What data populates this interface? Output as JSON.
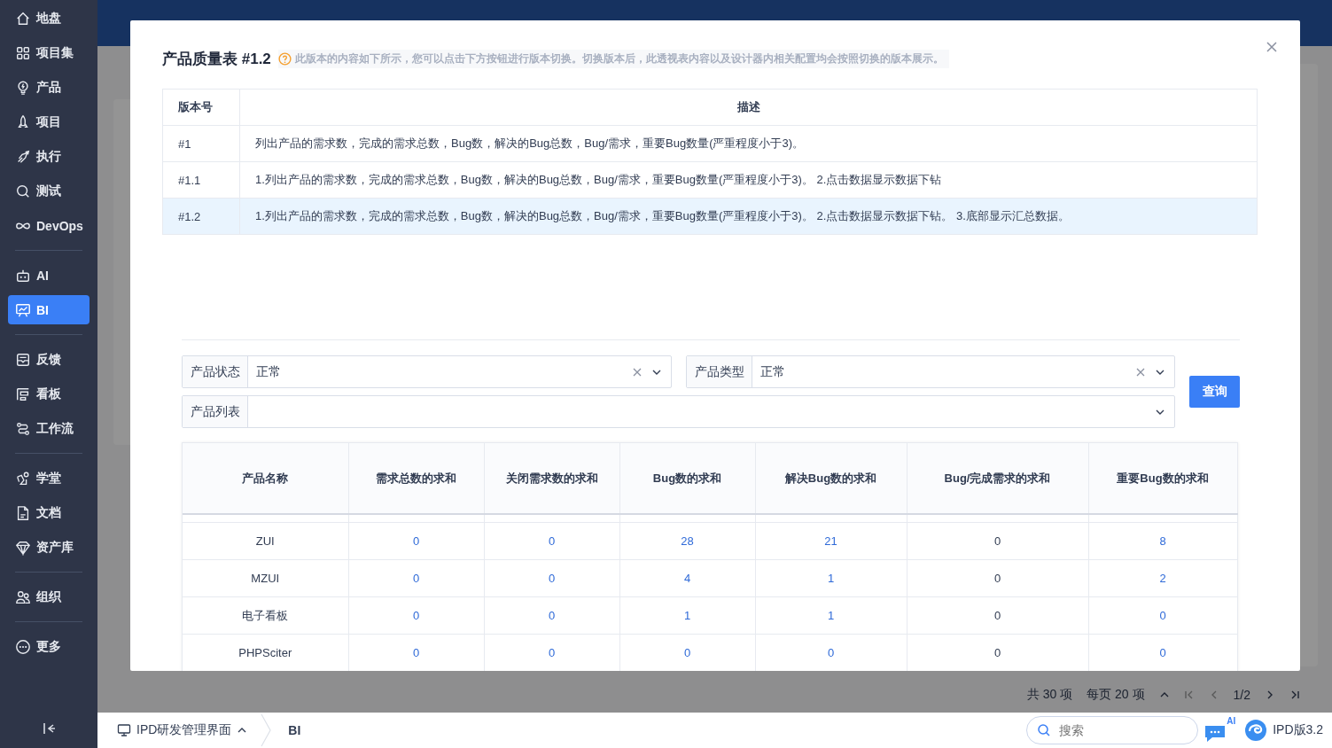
{
  "sidebar": {
    "groups": [
      [
        {
          "label": "地盘",
          "selected": false
        },
        {
          "label": "项目集",
          "selected": false
        },
        {
          "label": "产品",
          "selected": false
        },
        {
          "label": "项目",
          "selected": false
        },
        {
          "label": "执行",
          "selected": false
        },
        {
          "label": "测试",
          "selected": false
        },
        {
          "label": "DevOps",
          "selected": false
        }
      ],
      [
        {
          "label": "AI",
          "selected": false
        },
        {
          "label": "BI",
          "selected": true
        }
      ],
      [
        {
          "label": "反馈",
          "selected": false
        },
        {
          "label": "看板",
          "selected": false
        },
        {
          "label": "工作流",
          "selected": false
        }
      ],
      [
        {
          "label": "学堂",
          "selected": false
        },
        {
          "label": "文档",
          "selected": false
        },
        {
          "label": "资产库",
          "selected": false
        }
      ],
      [
        {
          "label": "组织",
          "selected": false
        }
      ],
      [
        {
          "label": "更多",
          "selected": false
        }
      ]
    ]
  },
  "pagination": {
    "total": "共 30 项",
    "page_size": "每页 20 项",
    "page": "1/2"
  },
  "bottom_bar": {
    "app": "IPD研发管理界面",
    "crumb": "BI",
    "search": {
      "placeholder": "搜索"
    },
    "ai_badge": "AI",
    "version": "IPD版3.2"
  },
  "modal": {
    "title": "产品质量表 #1.2",
    "hint": "此版本的内容如下所示，您可以点击下方按钮进行版本切换。切换版本后，此透视表内容以及设计器内相关配置均会按照切换的版本展示。",
    "versions": {
      "columns": [
        "版本号",
        "描述"
      ],
      "rows": [
        {
          "version": "#1",
          "description": "列出产品的需求数，完成的需求总数，Bug数，解决的Bug总数，Bug/需求，重要Bug数量(严重程度小于3)。",
          "selected": false
        },
        {
          "version": "#1.1",
          "description": "1.列出产品的需求数，完成的需求总数，Bug数，解决的Bug总数，Bug/需求，重要Bug数量(严重程度小于3)。 2.点击数据显示数据下钻",
          "selected": false
        },
        {
          "version": "#1.2",
          "description": "1.列出产品的需求数，完成的需求总数，Bug数，解决的Bug总数，Bug/需求，重要Bug数量(严重程度小于3)。 2.点击数据显示数据下钻。 3.底部显示汇总数据。",
          "selected": true
        }
      ]
    },
    "filters": [
      {
        "label": "产品状态",
        "value": "正常"
      },
      {
        "label": "产品类型",
        "value": "正常"
      },
      {
        "label": "产品列表"
      }
    ],
    "query_button": "查询",
    "table": {
      "columns": [
        {
          "label": "产品名称",
          "linked": false
        },
        {
          "label": "需求总数的求和",
          "linked": true
        },
        {
          "label": "关闭需求数的求和",
          "linked": true
        },
        {
          "label": "Bug数的求和",
          "linked": true
        },
        {
          "label": "解决Bug数的求和",
          "linked": true
        },
        {
          "label": "Bug/完成需求的求和",
          "linked": false
        },
        {
          "label": "重要Bug数的求和",
          "linked": true
        }
      ],
      "rows": [
        [
          "ZUI",
          "0",
          "0",
          "28",
          "21",
          "0",
          "8"
        ],
        [
          "MZUI",
          "0",
          "0",
          "4",
          "1",
          "0",
          "2"
        ],
        [
          "电子看板",
          "0",
          "0",
          "1",
          "1",
          "0",
          "0"
        ],
        [
          "PHPSciter",
          "0",
          "0",
          "0",
          "0",
          "0",
          "0"
        ]
      ]
    }
  }
}
